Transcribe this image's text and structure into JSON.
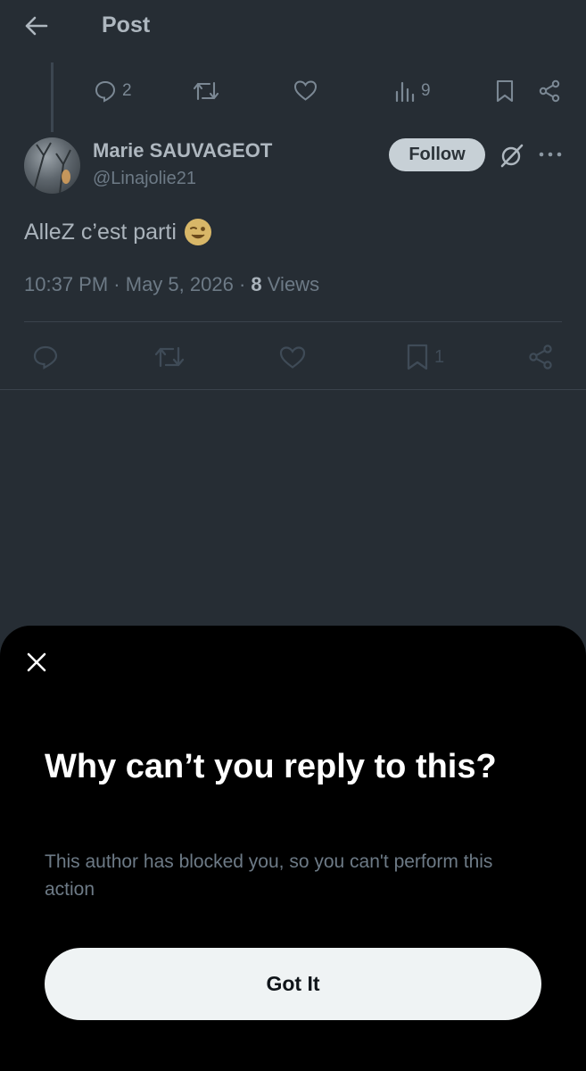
{
  "header": {
    "title": "Post",
    "back_icon": "arrow-left-icon"
  },
  "parent_actions": {
    "replies": "2",
    "views": "9"
  },
  "author": {
    "name": "Marie SAUVAGEOT",
    "handle": "@Linajolie21",
    "follow_label": "Follow"
  },
  "post": {
    "text": "AlleZ c’est parti",
    "emoji": "winking-face",
    "time": "10:37 PM",
    "date": "May 5, 2026",
    "views_count": "8",
    "views_label": "Views"
  },
  "actions": {
    "bookmarks": "1"
  },
  "sheet": {
    "title": "Why can’t you reply to this?",
    "description": "This author has blocked you, so you can't perform this action",
    "button_label": "Got It"
  },
  "colors": {
    "background": "#262d34",
    "sheet": "#000000",
    "follow_bg": "#c7d0d6",
    "button_bg": "#eff3f4",
    "muted": "#6d7a86"
  }
}
